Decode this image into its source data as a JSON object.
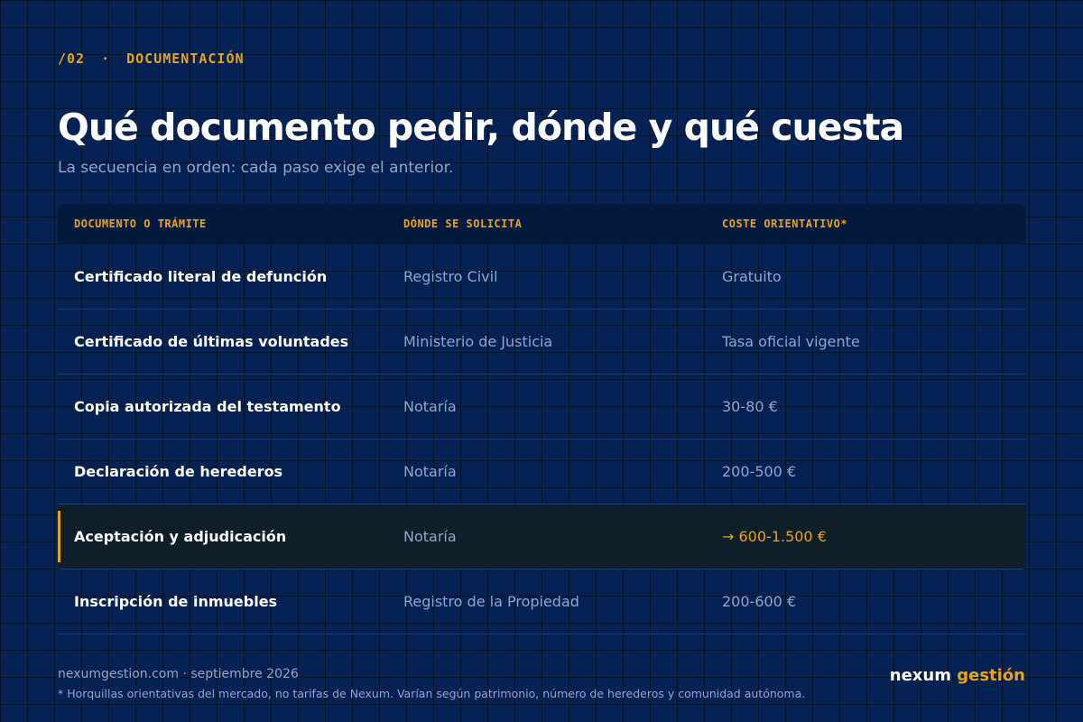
{
  "eyebrow": {
    "number": "/02",
    "separator": "·",
    "section": "DOCUMENTACIÓN"
  },
  "title": "Qué documento pedir, dónde y qué cuesta",
  "subtitle": "La secuencia en orden: cada paso exige el anterior.",
  "table": {
    "headers": [
      "DOCUMENTO O TRÁMITE",
      "DÓNDE SE SOLICITA",
      "COSTE ORIENTATIVO*"
    ],
    "rows": [
      {
        "document": "Certificado literal de defunción",
        "where": "Registro Civil",
        "cost": "Gratuito"
      },
      {
        "document": "Certificado de últimas voluntades",
        "where": "Ministerio de Justicia",
        "cost": "Tasa oficial vigente"
      },
      {
        "document": "Copia autorizada del testamento",
        "where": "Notaría",
        "cost": "30-80 €"
      },
      {
        "document": "Declaración de herederos",
        "where": "Notaría",
        "cost": "200-500 €"
      },
      {
        "document": "Aceptación y adjudicación",
        "where": "Notaría",
        "cost": "→ 600-1.500 €"
      },
      {
        "document": "Inscripción de inmuebles",
        "where": "Registro de la Propiedad",
        "cost": "200-600 €"
      }
    ]
  },
  "footer": {
    "site": "nexumgestion.com · septiembre 2026",
    "note": "* Horquillas orientativas del mercado, no tarifas de Nexum. Varían según patrimonio, número de herederos y comunidad autónoma."
  },
  "brand": {
    "part1": "nexum",
    "part2": "gestión"
  },
  "colors": {
    "background": "#052253",
    "accent": "#e8a317",
    "muted_text": "#8ea6cc",
    "header_row": "#031a3d",
    "highlight_row": "#0f1f2a"
  }
}
